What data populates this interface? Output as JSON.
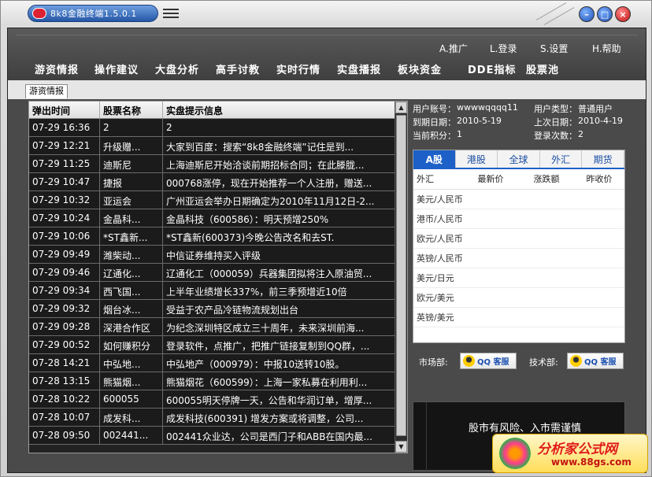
{
  "window": {
    "title": "8k8金融终端1.5.0.1"
  },
  "util_links": [
    "A.推广",
    "L.登录",
    "S.设置",
    "H.帮助"
  ],
  "nav": [
    "游资情报",
    "操作建议",
    "大盘分析",
    "高手讨教",
    "实时行情",
    "实盘播报",
    "板块资金",
    "DDE指标",
    "股票池"
  ],
  "active_tab": "游资情报",
  "table": {
    "headers": [
      "弹出时间",
      "股票名称",
      "实盘提示信息"
    ],
    "rows": [
      {
        "time": "07-29 16:36",
        "name": "2",
        "info": "2"
      },
      {
        "time": "07-29 12:21",
        "name": "升级赠...",
        "info": "大家到百度：搜索“8k8金融终端”记住是到..."
      },
      {
        "time": "07-29 11:25",
        "name": "迪斯尼",
        "info": "上海迪斯尼开始洽谈前期招标合同；在此滕胧..."
      },
      {
        "time": "07-29 10:47",
        "name": "捷报",
        "info": "000768涨停，现在开始推荐一个人注册，赠送..."
      },
      {
        "time": "07-29 10:32",
        "name": "亚运会",
        "info": "广州亚运会举办日期确定为2010年11月12日-2..."
      },
      {
        "time": "07-29 10:24",
        "name": "金晶科...",
        "info": "金晶科技（600586）：明天预增250%"
      },
      {
        "time": "07-29 10:06",
        "name": "*ST鑫新...",
        "info": "*ST鑫新(600373)今晚公告改名和去ST."
      },
      {
        "time": "07-29 09:49",
        "name": "潍柴动...",
        "info": "中信证券维持买入评级"
      },
      {
        "time": "07-29 09:46",
        "name": "辽通化...",
        "info": "辽通化工（000059）兵器集团拟将注入原油贸..."
      },
      {
        "time": "07-29 09:34",
        "name": "西飞国...",
        "info": "上半年业绩增长337%，前三季预增近10倍"
      },
      {
        "time": "07-29 09:32",
        "name": "烟台冰...",
        "info": "受益于农产品冷链物流规划出台"
      },
      {
        "time": "07-29 09:28",
        "name": "深港合作区",
        "info": "为纪念深圳特区成立三十周年，未来深圳前海..."
      },
      {
        "time": "07-29 00:52",
        "name": "如何赚积分",
        "info": "登录软件，点推广，把推广链接复制到QQ群，..."
      },
      {
        "time": "07-28 14:21",
        "name": "中弘地...",
        "info": "中弘地产（000979）：中报10送转10股。"
      },
      {
        "time": "07-28 13:15",
        "name": "熊猫烟...",
        "info": "熊猫烟花（600599）：上海一家私募在利用利..."
      },
      {
        "time": "07-28 10:22",
        "name": "600055",
        "info": "600055明天停牌一天，公告和华润订单，增厚..."
      },
      {
        "time": "07-28 10:07",
        "name": "成发科...",
        "info": "成发科技(600391) 增发方案或将调整，公司..."
      },
      {
        "time": "07-28 09:50",
        "name": "002441...",
        "info": "002441众业达，公司是西门子和ABB在国内最..."
      }
    ]
  },
  "user": {
    "account_label": "用户账号：",
    "account": "wwwwqqqq11",
    "type_label": "用户类型：",
    "type": "普通用户",
    "expire_label": "到期日期：",
    "expire": "2010-5-19",
    "last_label": "上次日期：",
    "last": "2010-4-19",
    "points_label": "当前积分：",
    "points": "1",
    "logins_label": "登录次数：",
    "logins": "2"
  },
  "fx": {
    "tabs": [
      "A股",
      "港股",
      "全球",
      "外汇",
      "期货"
    ],
    "active_tab": "A股",
    "headers": [
      "外汇",
      "最新价",
      "涨跌额",
      "昨收价"
    ],
    "rows": [
      "美元/人民币",
      "港币/人民币",
      "欧元/人民币",
      "英镑/人民币",
      "美元/日元",
      "欧元/美元",
      "英镑/美元"
    ]
  },
  "contact": {
    "market_label": "市场部:",
    "tech_label": "技术部:",
    "qq_label": "QQ 客服"
  },
  "risk_banner": "股市有风险、入市需谨慎",
  "watermark": {
    "title": "分析家公式网",
    "url": "www.88gs.com"
  }
}
